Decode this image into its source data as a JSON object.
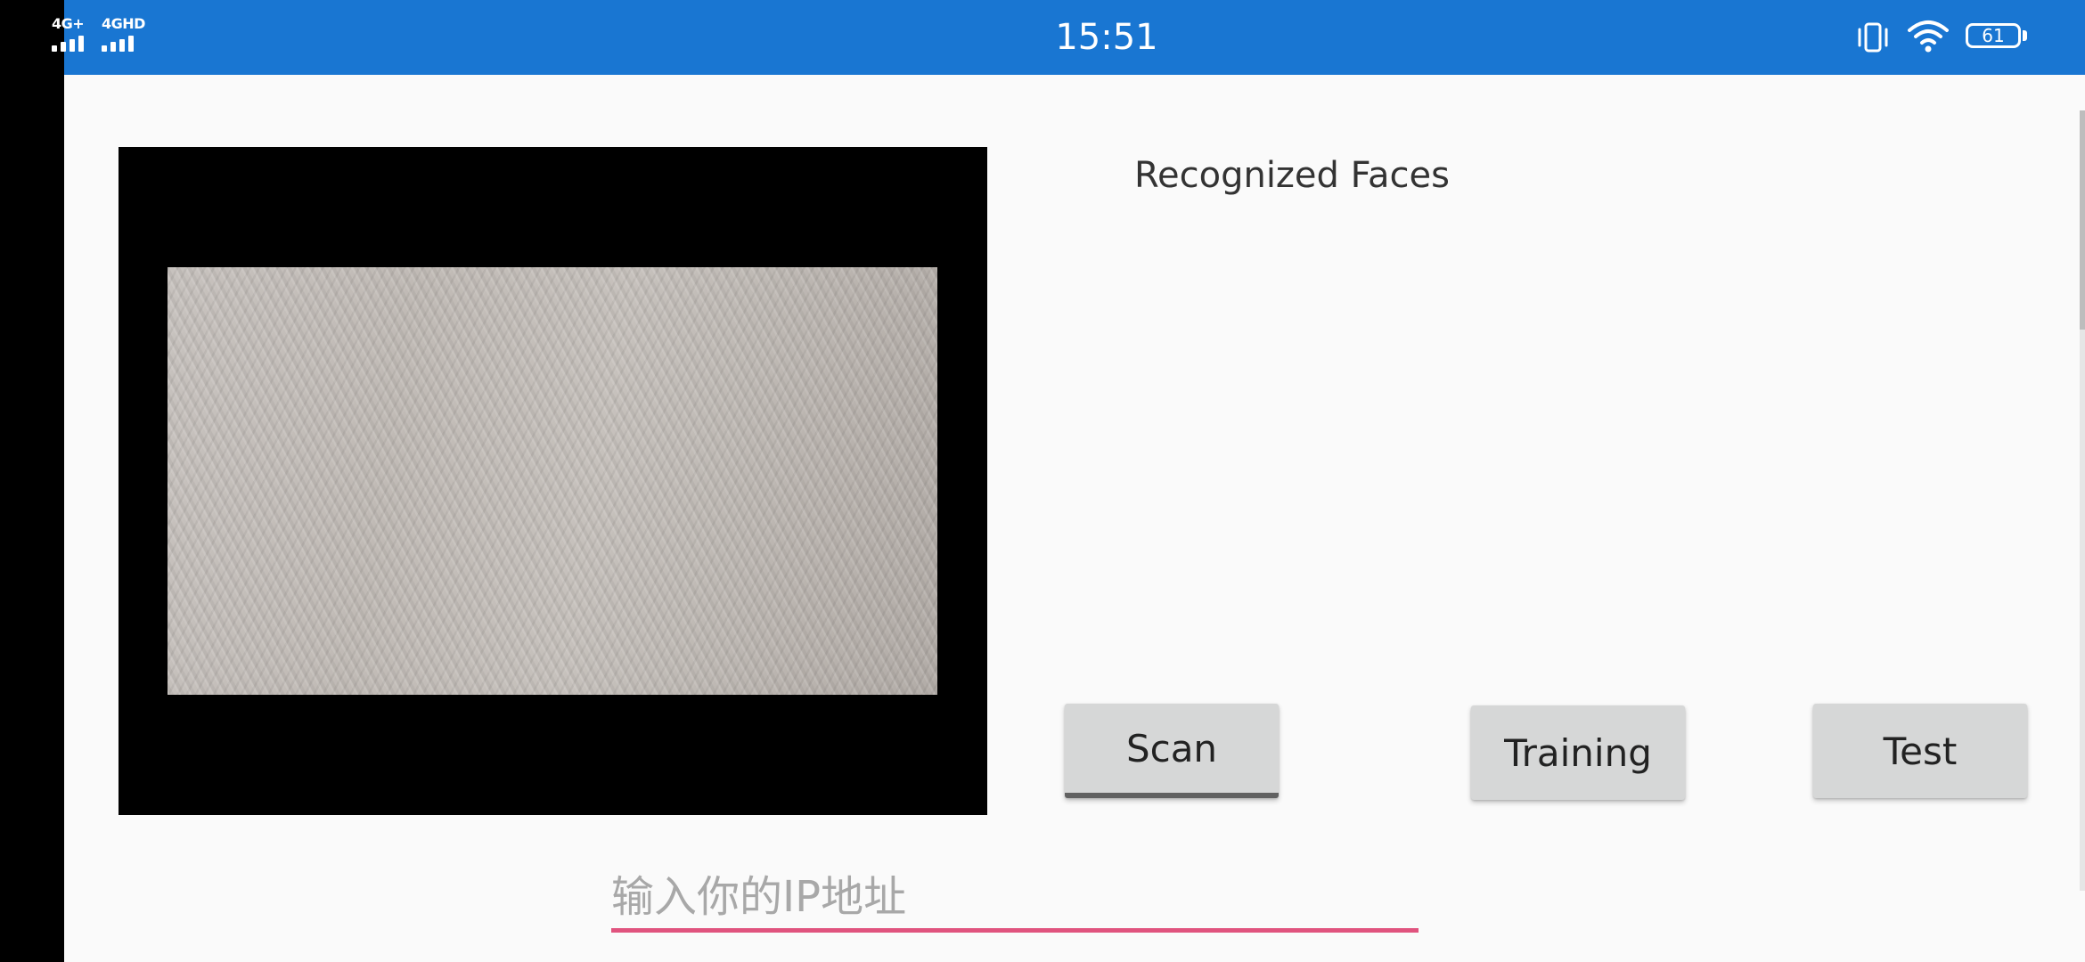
{
  "status_bar": {
    "network_1": "4G+",
    "network_2": "4GHD",
    "time": "15:51",
    "battery": "61",
    "icons": [
      "signal-icon",
      "vibrate-icon",
      "wifi-icon",
      "battery-icon"
    ],
    "background_color": "#1976D2"
  },
  "main": {
    "faces_title": "Recognized Faces"
  },
  "buttons": {
    "scan": "Scan",
    "training": "Training",
    "test": "Test"
  },
  "ip_input": {
    "placeholder": "输入你的IP地址",
    "value": "",
    "accent_color": "#E0537E"
  }
}
